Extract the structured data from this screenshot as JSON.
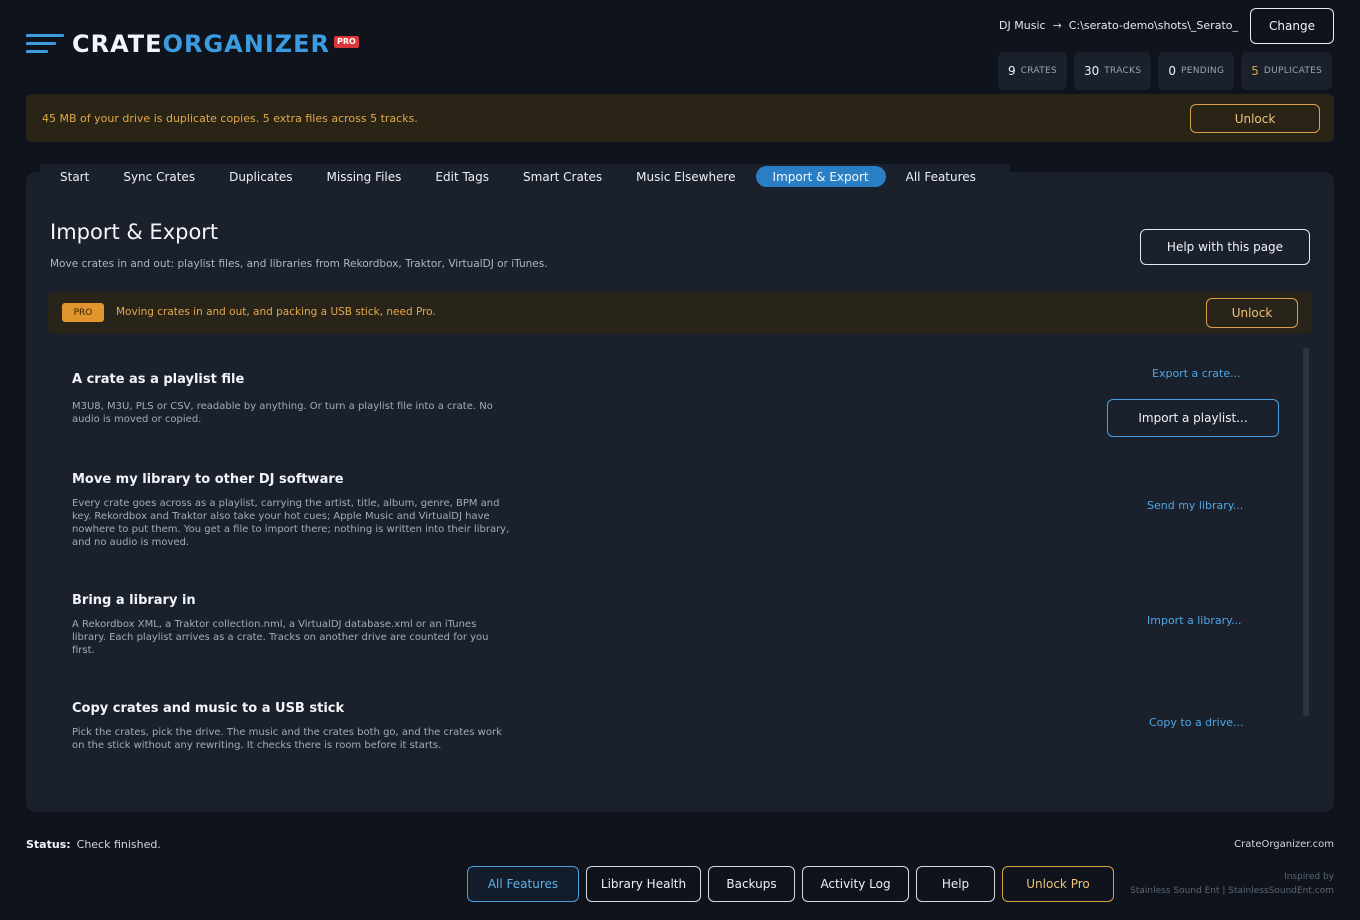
{
  "app": {
    "logo_word1": "CRATE",
    "logo_word2": "ORGANIZER",
    "logo_badge": "PRO"
  },
  "header": {
    "library_name": "DJ Music",
    "arrow": "→",
    "library_path": "C:\\serato-demo\\shots\\_Serato_",
    "change_label": "Change",
    "stats": [
      {
        "num": "9",
        "label": "CRATES"
      },
      {
        "num": "30",
        "label": "TRACKS"
      },
      {
        "num": "0",
        "label": "PENDING"
      },
      {
        "num": "5",
        "label": "DUPLICATES"
      }
    ]
  },
  "banner": {
    "message": "45 MB of your drive is duplicate copies. 5 extra files across 5 tracks.",
    "unlock_label": "Unlock"
  },
  "tabs": [
    "Start",
    "Sync Crates",
    "Duplicates",
    "Missing Files",
    "Edit Tags",
    "Smart Crates",
    "Music Elsewhere",
    "Import & Export",
    "All Features"
  ],
  "active_tab": "Import & Export",
  "page": {
    "title": "Import & Export",
    "subtitle": "Move crates in and out: playlist files, and libraries from Rekordbox, Traktor, VirtualDJ or iTunes.",
    "help_label": "Help with this page",
    "pro_badge": "PRO",
    "pro_message": "Moving crates in and out, and packing a USB stick, need Pro.",
    "pro_unlock_label": "Unlock",
    "sections": [
      {
        "title": "A crate as a playlist file",
        "desc": "M3U8, M3U, PLS or CSV, readable by anything. Or turn a playlist file into a crate. No audio is moved or copied.",
        "action": "Export a crate...",
        "action2": "Import a playlist..."
      },
      {
        "title": "Move my library to other DJ software",
        "desc": "Every crate goes across as a playlist, carrying the artist, title, album, genre, BPM and key. Rekordbox and Traktor also take your hot cues; Apple Music and VirtualDJ have nowhere to put them. You get a file to import there; nothing is written into their library, and no audio is moved.",
        "action": "Send my library..."
      },
      {
        "title": "Bring a library in",
        "desc": "A Rekordbox XML, a Traktor collection.nml, a VirtualDJ database.xml or an iTunes library. Each playlist arrives as a crate. Tracks on another drive are counted for you first.",
        "action": "Import a library..."
      },
      {
        "title": "Copy crates and music to a USB stick",
        "desc": "Pick the crates, pick the drive. The music and the crates both go, and the crates work on the stick without any rewriting. It checks there is room before it starts.",
        "action": "Copy to a drive..."
      }
    ]
  },
  "footer": {
    "status_label": "Status:",
    "status_text": "Check finished.",
    "site": "CrateOrganizer.com",
    "buttons": [
      "All Features",
      "Library Health",
      "Backups",
      "Activity Log",
      "Help",
      "Unlock Pro"
    ],
    "inspired_line1": "Inspired by",
    "inspired_line2": "Stainless Sound Ent | StainlessSoundEnt.com"
  }
}
